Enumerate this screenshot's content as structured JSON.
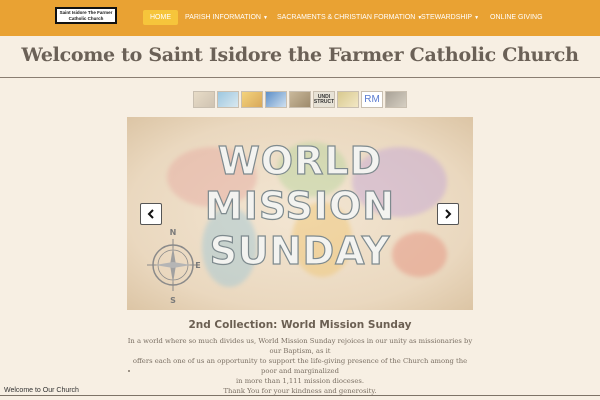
{
  "navbar": {
    "logo_line1": "Saint Isidore The Farmer",
    "logo_line2": "Catholic Church",
    "items": [
      {
        "label": "HOME",
        "caret": ""
      },
      {
        "label": "PARISH INFORMATION",
        "caret": "▼"
      },
      {
        "label": "SACRAMENTS & CHRISTIAN FORMATION",
        "caret": "▼"
      },
      {
        "label": "STEWARDSHIP",
        "caret": "▼"
      },
      {
        "label": "ONLINE GIVING",
        "caret": ""
      }
    ],
    "active_color": "#f6c53b",
    "bar_color": "#e9a233"
  },
  "page_title": "Welcome to Saint Isidore the Farmer Catholic Church",
  "thumbnails": {
    "t6_text": "UNDI STRUCT",
    "t8_text": "RM"
  },
  "carousel": {
    "slide_text_line1": "WORLD",
    "slide_text_line2": "MISSION",
    "slide_text_line3": "SUNDAY",
    "compass_n": "N",
    "compass_e": "E",
    "compass_s": "S",
    "prev_icon": "chevron-left-icon",
    "next_icon": "chevron-right-icon"
  },
  "collection": {
    "title": "2nd Collection: World Mission Sunday",
    "line1": "In a world where so much divides us, World Mission Sunday rejoices in our unity as missionaries by our Baptism, as it",
    "line2": "offers each one of us an opportunity to support the life-giving presence of the Church among the poor and marginalized",
    "line3": "in more than 1,111 mission dioceses.",
    "line4": "Thank You for your kindness and generosity."
  },
  "footer": {
    "label": "Welcome to Our Church"
  }
}
